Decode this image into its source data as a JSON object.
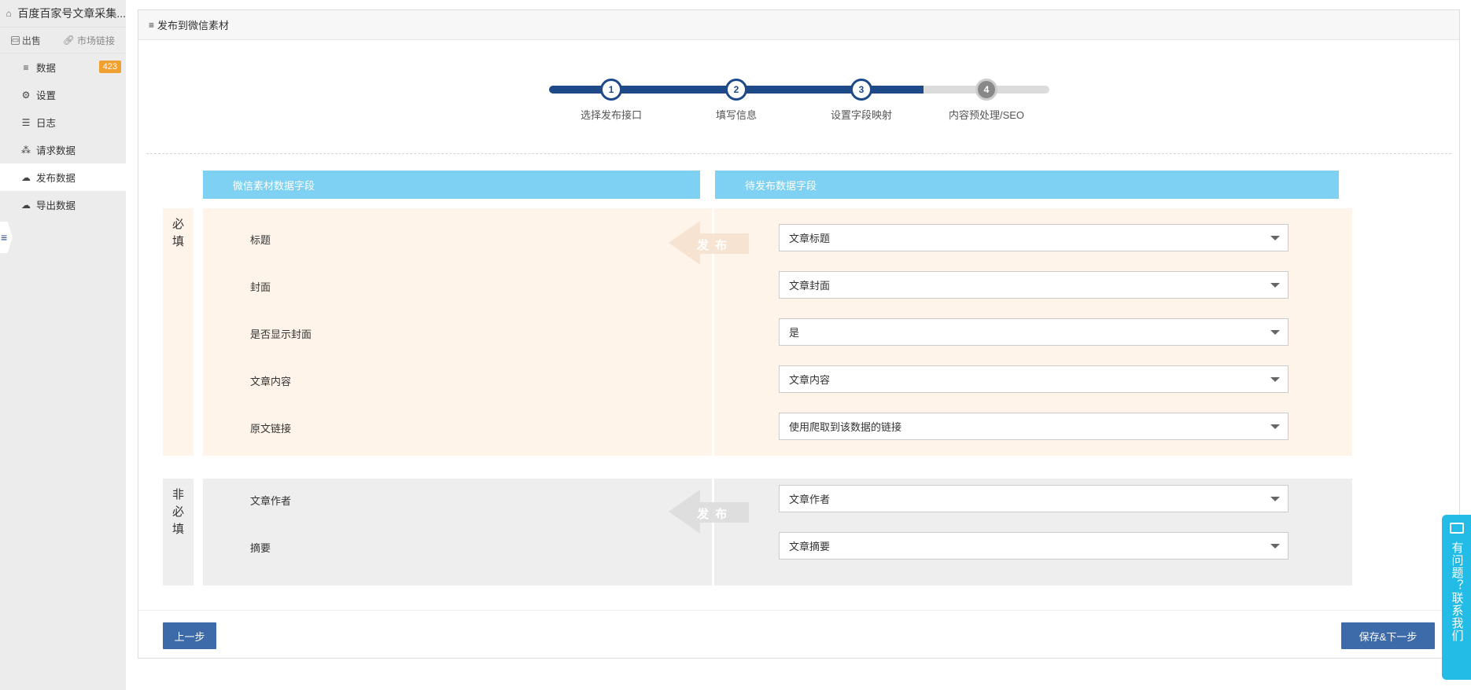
{
  "sidebar": {
    "app_title": "百度百家号文章采集...",
    "quick_links": {
      "sell": "出售",
      "market_link": "市场链接"
    },
    "items": [
      {
        "label": "数据",
        "badge": "423"
      },
      {
        "label": "设置"
      },
      {
        "label": "日志"
      },
      {
        "label": "请求数据"
      },
      {
        "label": "发布数据"
      },
      {
        "label": "导出数据"
      }
    ]
  },
  "panel": {
    "title": "发布到微信素材"
  },
  "steps": [
    {
      "num": "1",
      "label": "选择发布接口"
    },
    {
      "num": "2",
      "label": "填写信息"
    },
    {
      "num": "3",
      "label": "设置字段映射"
    },
    {
      "num": "4",
      "label": "内容预处理/SEO"
    }
  ],
  "mapping": {
    "left_header": "微信素材数据字段",
    "right_header": "待发布数据字段",
    "arrow_text": "发 布",
    "required": {
      "label": "必填",
      "rows": [
        {
          "field": "标题",
          "value": "文章标题"
        },
        {
          "field": "封面",
          "value": "文章封面"
        },
        {
          "field": "是否显示封面",
          "value": "是"
        },
        {
          "field": "文章内容",
          "value": "文章内容"
        },
        {
          "field": "原文链接",
          "value": "使用爬取到该数据的链接"
        }
      ]
    },
    "optional": {
      "label": "非必填",
      "rows": [
        {
          "field": "文章作者",
          "value": "文章作者"
        },
        {
          "field": "摘要",
          "value": "文章摘要"
        }
      ]
    }
  },
  "buttons": {
    "prev": "上一步",
    "save_next": "保存&下一步"
  },
  "help_widget": {
    "text": "有问题？联系我们"
  }
}
